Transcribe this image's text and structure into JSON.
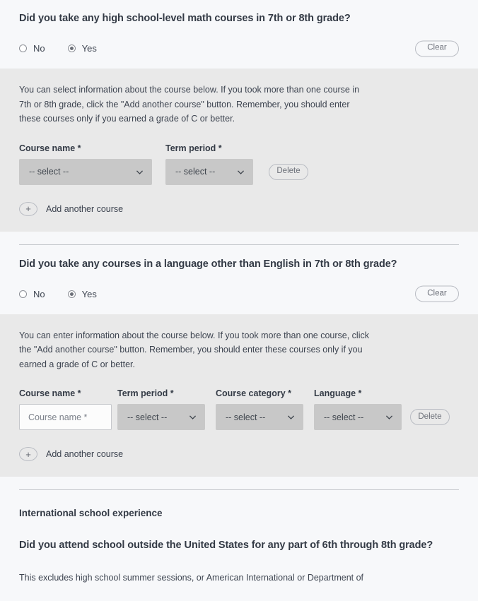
{
  "sections": {
    "math": {
      "question": "Did you take any high school-level math courses in 7th or 8th grade?",
      "options": [
        {
          "label": "No",
          "checked": false
        },
        {
          "label": "Yes",
          "checked": true
        }
      ],
      "clear_label": "Clear",
      "panel_text": "You can select information about the course below. If you took more than one course in 7th or 8th grade, click the \"Add another course\" button. Remember, you should enter these courses only if you earned a grade of C or better.",
      "fields": [
        {
          "label": "Course name *",
          "type": "select",
          "value": "-- select --"
        },
        {
          "label": "Term period *",
          "type": "select",
          "value": "-- select --"
        }
      ],
      "delete_label": "Delete",
      "add_label": "Add another course",
      "plus_glyph": "+"
    },
    "language": {
      "question": "Did you take any courses in a language other than English in 7th or 8th grade?",
      "options": [
        {
          "label": "No",
          "checked": false
        },
        {
          "label": "Yes",
          "checked": true
        }
      ],
      "clear_label": "Clear",
      "panel_text": "You can enter information about the course below. If you took more than one course, click the \"Add another course\" button. Remember, you should enter these courses only if you earned a grade of C or better.",
      "fields": [
        {
          "label": "Course name *",
          "type": "text",
          "value": "",
          "placeholder": "Course name *"
        },
        {
          "label": "Term period *",
          "type": "select",
          "value": "-- select --"
        },
        {
          "label": "Course category *",
          "type": "select",
          "value": "-- select --"
        },
        {
          "label": "Language *",
          "type": "select",
          "value": "-- select --"
        }
      ],
      "delete_label": "Delete",
      "add_label": "Add another course",
      "plus_glyph": "+"
    },
    "international": {
      "heading": "International school experience",
      "question": "Did you attend school outside the United States for any part of 6th through 8th grade?",
      "note": "This excludes high school summer sessions, or American International or Department of"
    }
  },
  "colors": {
    "page_background": "#f7f8fa",
    "panel_background": "#e9e9e9",
    "select_background": "#c8c8c8",
    "text": "#3d4450",
    "border": "#b9bcc3"
  }
}
